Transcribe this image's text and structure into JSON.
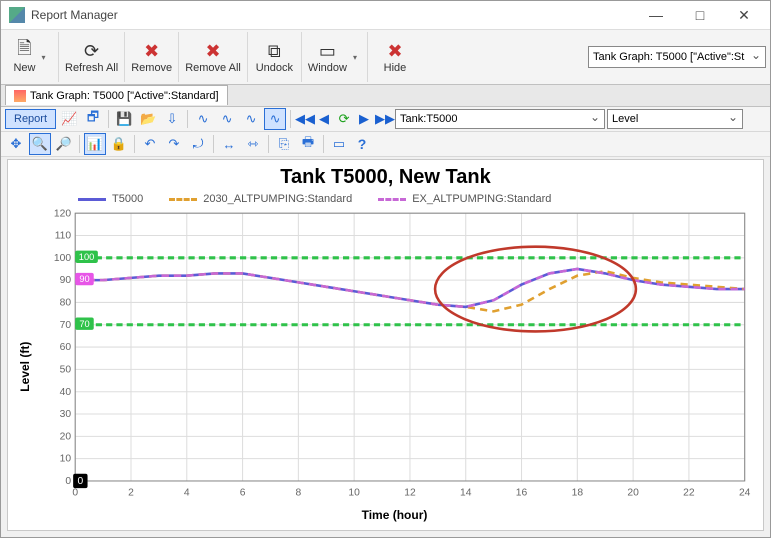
{
  "window": {
    "title": "Report Manager"
  },
  "toolbar": {
    "new": "New",
    "refresh_all": "Refresh All",
    "remove": "Remove",
    "remove_all": "Remove All",
    "undock": "Undock",
    "window": "Window",
    "hide": "Hide",
    "tank_combo": "Tank Graph: T5000 [\"Active\":St"
  },
  "tab": {
    "label": "Tank Graph: T5000 [\"Active\":Standard]"
  },
  "toolbar2": {
    "report": "Report",
    "tank_select": "Tank:T5000",
    "series_select": "Level"
  },
  "chart": {
    "title": "Tank T5000, New Tank",
    "ylabel": "Level (ft)",
    "xlabel": "Time (hour)",
    "legend": {
      "s1": "T5000",
      "s2": "2030_ALTPUMPING:Standard",
      "s3": "EX_ALTPUMPING:Standard"
    },
    "markers": {
      "m100": "100",
      "m90": "90",
      "m70": "70",
      "m0": "0"
    }
  },
  "chart_data": {
    "type": "line",
    "xlabel": "Time (hour)",
    "ylabel": "Level (ft)",
    "xlim": [
      0,
      24
    ],
    "ylim": [
      0,
      120
    ],
    "xticks": [
      0,
      2,
      4,
      6,
      8,
      10,
      12,
      14,
      16,
      18,
      20,
      22,
      24
    ],
    "yticks": [
      0,
      10,
      20,
      30,
      40,
      50,
      60,
      70,
      80,
      90,
      100,
      110,
      120
    ],
    "reference_lines": [
      {
        "y": 100,
        "color": "#2fc24a",
        "style": "dashed"
      },
      {
        "y": 70,
        "color": "#2fc24a",
        "style": "dashed"
      }
    ],
    "annotation": {
      "type": "ellipse",
      "cx": 16.5,
      "cy": 86,
      "rx": 3.6,
      "ry": 19,
      "color": "#c0392b"
    },
    "x": [
      0,
      1,
      2,
      3,
      4,
      5,
      6,
      7,
      8,
      9,
      10,
      11,
      12,
      13,
      14,
      15,
      16,
      17,
      18,
      19,
      20,
      21,
      22,
      23,
      24
    ],
    "series": [
      {
        "name": "T5000",
        "color": "#5b5bd6",
        "style": "solid",
        "values": [
          90,
          90,
          91,
          92,
          92,
          93,
          93,
          91,
          89,
          87,
          85,
          83,
          81,
          79,
          78,
          81,
          88,
          93,
          95,
          93,
          90,
          88,
          87,
          86,
          86
        ]
      },
      {
        "name": "2030_ALTPUMPING:Standard",
        "color": "#e0a030",
        "style": "dashed",
        "values": [
          90,
          90,
          91,
          92,
          92,
          93,
          93,
          91,
          89,
          87,
          85,
          83,
          81,
          79,
          78,
          76,
          79,
          86,
          92,
          94,
          91,
          89,
          88,
          87,
          86
        ]
      },
      {
        "name": "EX_ALTPUMPING:Standard",
        "color": "#c768d6",
        "style": "dashed",
        "values": [
          90,
          90,
          91,
          92,
          92,
          93,
          93,
          91,
          89,
          87,
          85,
          83,
          81,
          79,
          78,
          81,
          88,
          93,
          95,
          93,
          90,
          88,
          87,
          86,
          86
        ]
      }
    ]
  }
}
